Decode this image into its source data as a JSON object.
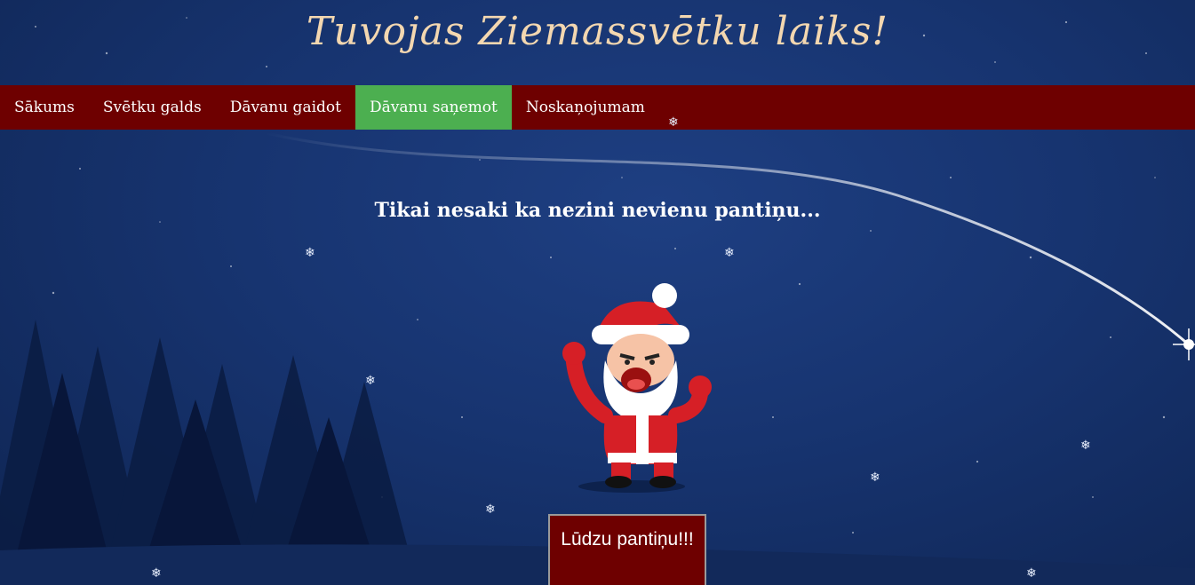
{
  "header": {
    "title": "Tuvojas Ziemassvētku laiks!"
  },
  "nav": {
    "items": [
      {
        "label": "Sākums"
      },
      {
        "label": "Svētku galds"
      },
      {
        "label": "Dāvanu gaidot"
      },
      {
        "label": "Dāvanu saņemot",
        "active": true
      },
      {
        "label": "Noskaņojumam"
      }
    ]
  },
  "main": {
    "subtitle": "Tikai nesaki ka nezini nevienu pantiņu...",
    "button_label": "Lūdzu pantiņu!!!"
  },
  "icons": {
    "snowflake": "snowflake-icon",
    "santa": "santa-illustration",
    "trees": "pine-trees-silhouette"
  },
  "colors": {
    "nav_bg": "#6e0000",
    "nav_active": "#4caf50",
    "title": "#f3d7b0",
    "sky": "#173470"
  }
}
